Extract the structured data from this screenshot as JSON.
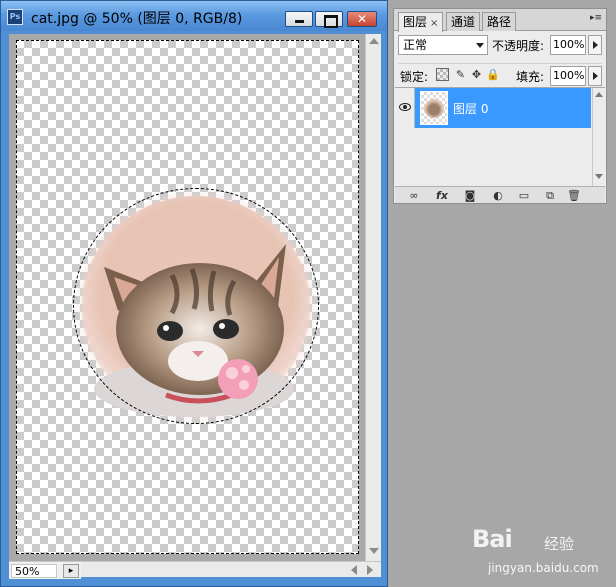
{
  "document": {
    "title": "cat.jpg @ 50% (图层 0, RGB/8)",
    "app_icon_text": "Ps",
    "zoom": "50%"
  },
  "window_controls": {
    "minimize": "minimize",
    "maximize": "maximize",
    "close": "✕"
  },
  "layers_panel": {
    "tabs": [
      {
        "label": "图层",
        "active": true
      },
      {
        "label": "通道",
        "active": false
      },
      {
        "label": "路径",
        "active": false
      }
    ],
    "tab_close": "×",
    "menu_glyph": "▸≡",
    "blend_mode": "正常",
    "opacity_label": "不透明度:",
    "opacity_value": "100%",
    "lock_label": "锁定:",
    "fill_label": "填充:",
    "fill_value": "100%",
    "layers": [
      {
        "name": "图层 0",
        "visible": true,
        "selected": true
      }
    ],
    "footer_icons": [
      "link-icon",
      "fx-icon",
      "mask-icon",
      "adjustment-icon",
      "folder-icon",
      "new-layer-icon",
      "trash-icon"
    ],
    "footer_glyphs": {
      "link": "∞",
      "fx": "fx",
      "mask": "◙",
      "adjust": "◐",
      "folder": "▭",
      "new": "⧉",
      "trash": "🗑"
    }
  },
  "lock_glyphs": {
    "brush": "✎",
    "move": "✥",
    "all": "🔒"
  },
  "status": {
    "nav_glyph": "▸"
  },
  "watermark": {
    "logo": "Bai",
    "logo_suffix": "经验",
    "url": "jingyan.baidu.com"
  },
  "colors": {
    "selection_highlight": "#3a99ff",
    "title_bar": "#5a9ae0",
    "workspace": "#a7a7a7"
  }
}
